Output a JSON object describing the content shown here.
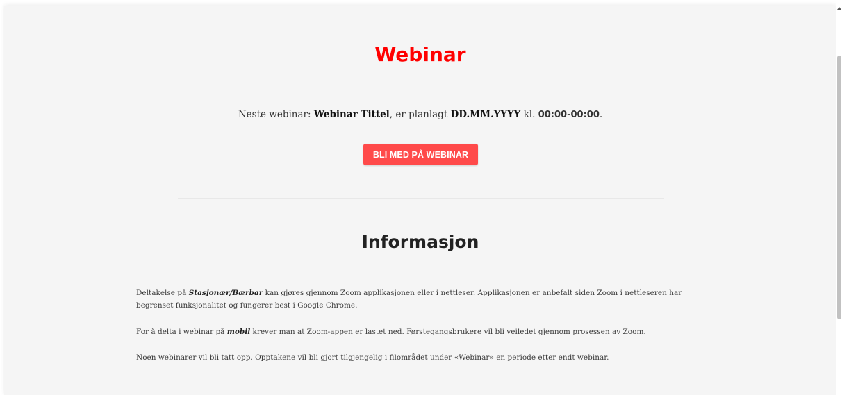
{
  "hero": {
    "title": "Webinar"
  },
  "next_webinar": {
    "prefix": "Neste webinar: ",
    "title": "Webinar Tittel",
    "middle": ", er planlagt ",
    "date": "DD.MM.YYYY",
    "kl": " kl. ",
    "time": "00:00-00:00",
    "suffix": "."
  },
  "join_button": {
    "label": "BLI MED PÅ WEBINAR"
  },
  "info": {
    "title": "Informasjon",
    "p1": {
      "before": "Deltakelse på ",
      "emph": "Stasjonær/Bærbar",
      "after": " kan gjøres gjennom Zoom applikasjonen eller i nettleser. Applikasjonen er anbefalt siden Zoom i nettleseren har begrenset funksjonalitet og fungerer best i Google Chrome."
    },
    "p2": {
      "before": "For å delta i webinar på ",
      "emph": "mobil",
      "after": " krever man at Zoom-appen er lastet ned. Førstegangsbrukere vil bli veiledet gjennom prosessen av Zoom."
    },
    "p3": "Noen webinarer vil bli tatt opp. Opptakene vil bli gjort tilgjengelig i filområdet under «Webinar» en periode etter endt webinar."
  },
  "colors": {
    "accent": "#ff0000",
    "button": "#ff4a4a",
    "background": "#f5f5f5"
  }
}
